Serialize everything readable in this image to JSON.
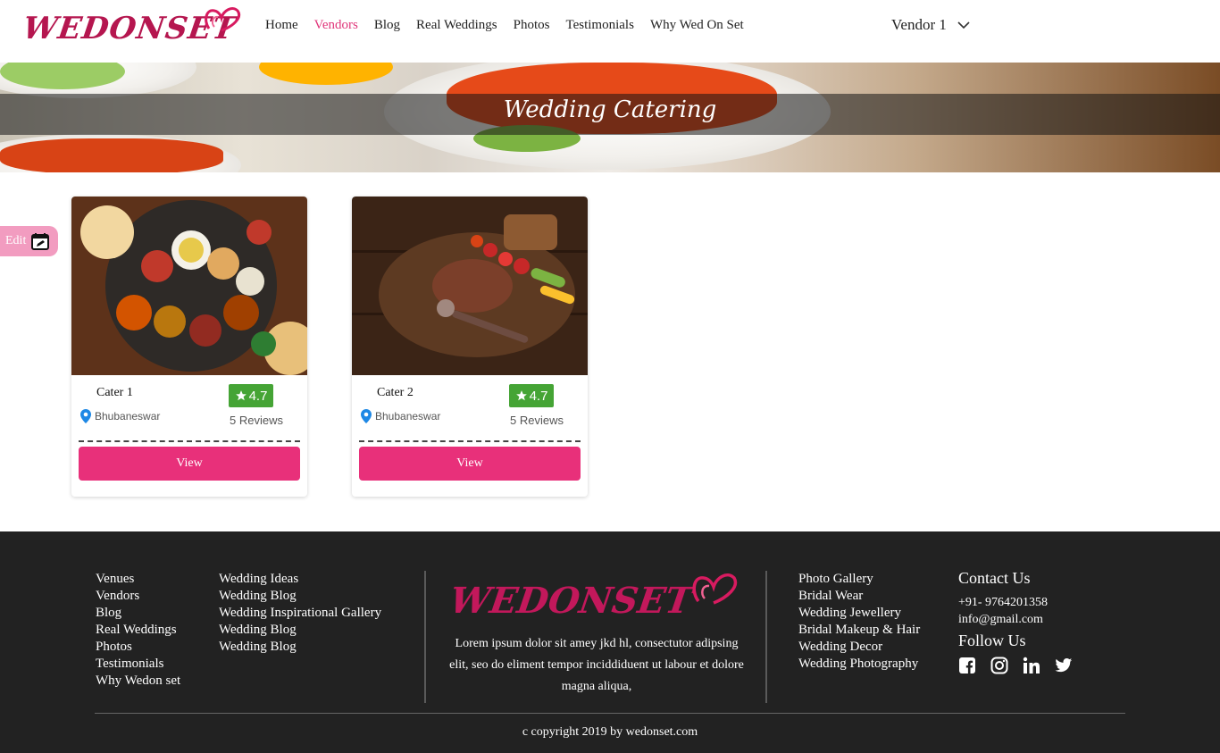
{
  "header": {
    "logo_text": "WEDONSET",
    "nav": [
      {
        "label": "Home",
        "active": false
      },
      {
        "label": "Vendors",
        "active": true
      },
      {
        "label": "Blog",
        "active": false
      },
      {
        "label": "Real Weddings",
        "active": false
      },
      {
        "label": "Photos",
        "active": false
      },
      {
        "label": "Testimonials",
        "active": false
      },
      {
        "label": "Why Wed On Set",
        "active": false
      }
    ],
    "user_menu": "Vendor 1"
  },
  "banner": {
    "title": "Wedding Catering"
  },
  "edit_tab": {
    "label": "Edit",
    "icon": "edit-calendar-icon"
  },
  "cards": [
    {
      "name": "Cater 1",
      "location": "Bhubaneswar",
      "rating": "4.7",
      "reviews": "5 Reviews",
      "button": "View"
    },
    {
      "name": "Cater 2",
      "location": "Bhubaneswar",
      "rating": "4.7",
      "reviews": "5 Reviews",
      "button": "View"
    }
  ],
  "footer": {
    "col1": [
      "Venues",
      "Vendors",
      "Blog",
      "Real Weddings",
      "Photos",
      "Testimonials",
      "Why Wedon set"
    ],
    "col2": [
      "Wedding Ideas",
      "Wedding Blog",
      "Wedding Inspirational Gallery",
      "Wedding Blog",
      "Wedding Blog"
    ],
    "logo_text": "WEDONSET",
    "description": "Lorem ipsum dolor sit amey jkd hl, consectutor adipsing elit, seo do eliment tempor inciddiduent ut labour et dolore magna aliqua,",
    "col3": [
      "Photo Gallery",
      "Bridal Wear",
      "Wedding Jewellery",
      "Bridal Makeup & Hair",
      "Wedding Decor",
      "Wedding Photography"
    ],
    "contact_title": "Contact Us",
    "phone": "+91- 9764201358",
    "email": "info@gmail.com",
    "follow_title": "Follow Us",
    "socials": [
      "facebook-icon",
      "instagram-icon",
      "linkedin-icon",
      "twitter-icon"
    ],
    "copyright": "c copyright 2019 by wedonset.com"
  },
  "colors": {
    "brand_pink": "#e8307a",
    "rating_green": "#45a435",
    "footer_bg": "#222222"
  }
}
